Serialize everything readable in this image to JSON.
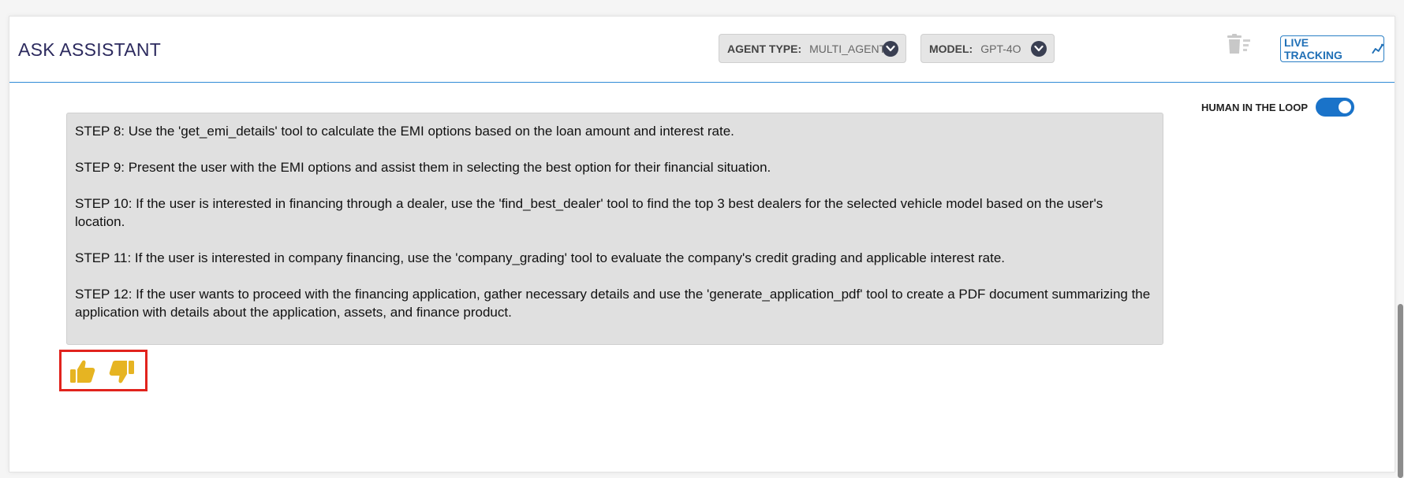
{
  "header": {
    "title": "ASK ASSISTANT",
    "agent_type": {
      "label": "AGENT TYPE:",
      "value": "MULTI_AGENT"
    },
    "model": {
      "label": "MODEL:",
      "value": "GPT-4O"
    },
    "live_tracking_label": "LIVE TRACKING"
  },
  "hitl": {
    "label": "HUMAN IN THE LOOP",
    "enabled": true
  },
  "message": {
    "steps": [
      "STEP 8: Use the 'get_emi_details' tool to calculate the EMI options based on the loan amount and interest rate.",
      "STEP 9: Present the user with the EMI options and assist them in selecting the best option for their financial situation.",
      "STEP 10: If the user is interested in financing through a dealer, use the 'find_best_dealer' tool to find the top 3 best dealers for the selected vehicle model based on the user's location.",
      "STEP 11: If the user is interested in company financing, use the 'company_grading' tool to evaluate the company's credit grading and applicable interest rate.",
      "STEP 12: If the user wants to proceed with the financing application, gather necessary details and use the 'generate_application_pdf' tool to create a PDF document summarizing the application with details about the application, assets, and finance product."
    ]
  },
  "icons": {
    "trash": "trash-icon",
    "live_tracking": "chart-line-icon",
    "thumbs_up": "thumbs-up-icon",
    "thumbs_down": "thumbs-down-icon"
  },
  "colors": {
    "accent": "#1a73c9",
    "title": "#2c2a5e",
    "feedback_icon": "#e6b422",
    "highlight_border": "#e1231d"
  }
}
